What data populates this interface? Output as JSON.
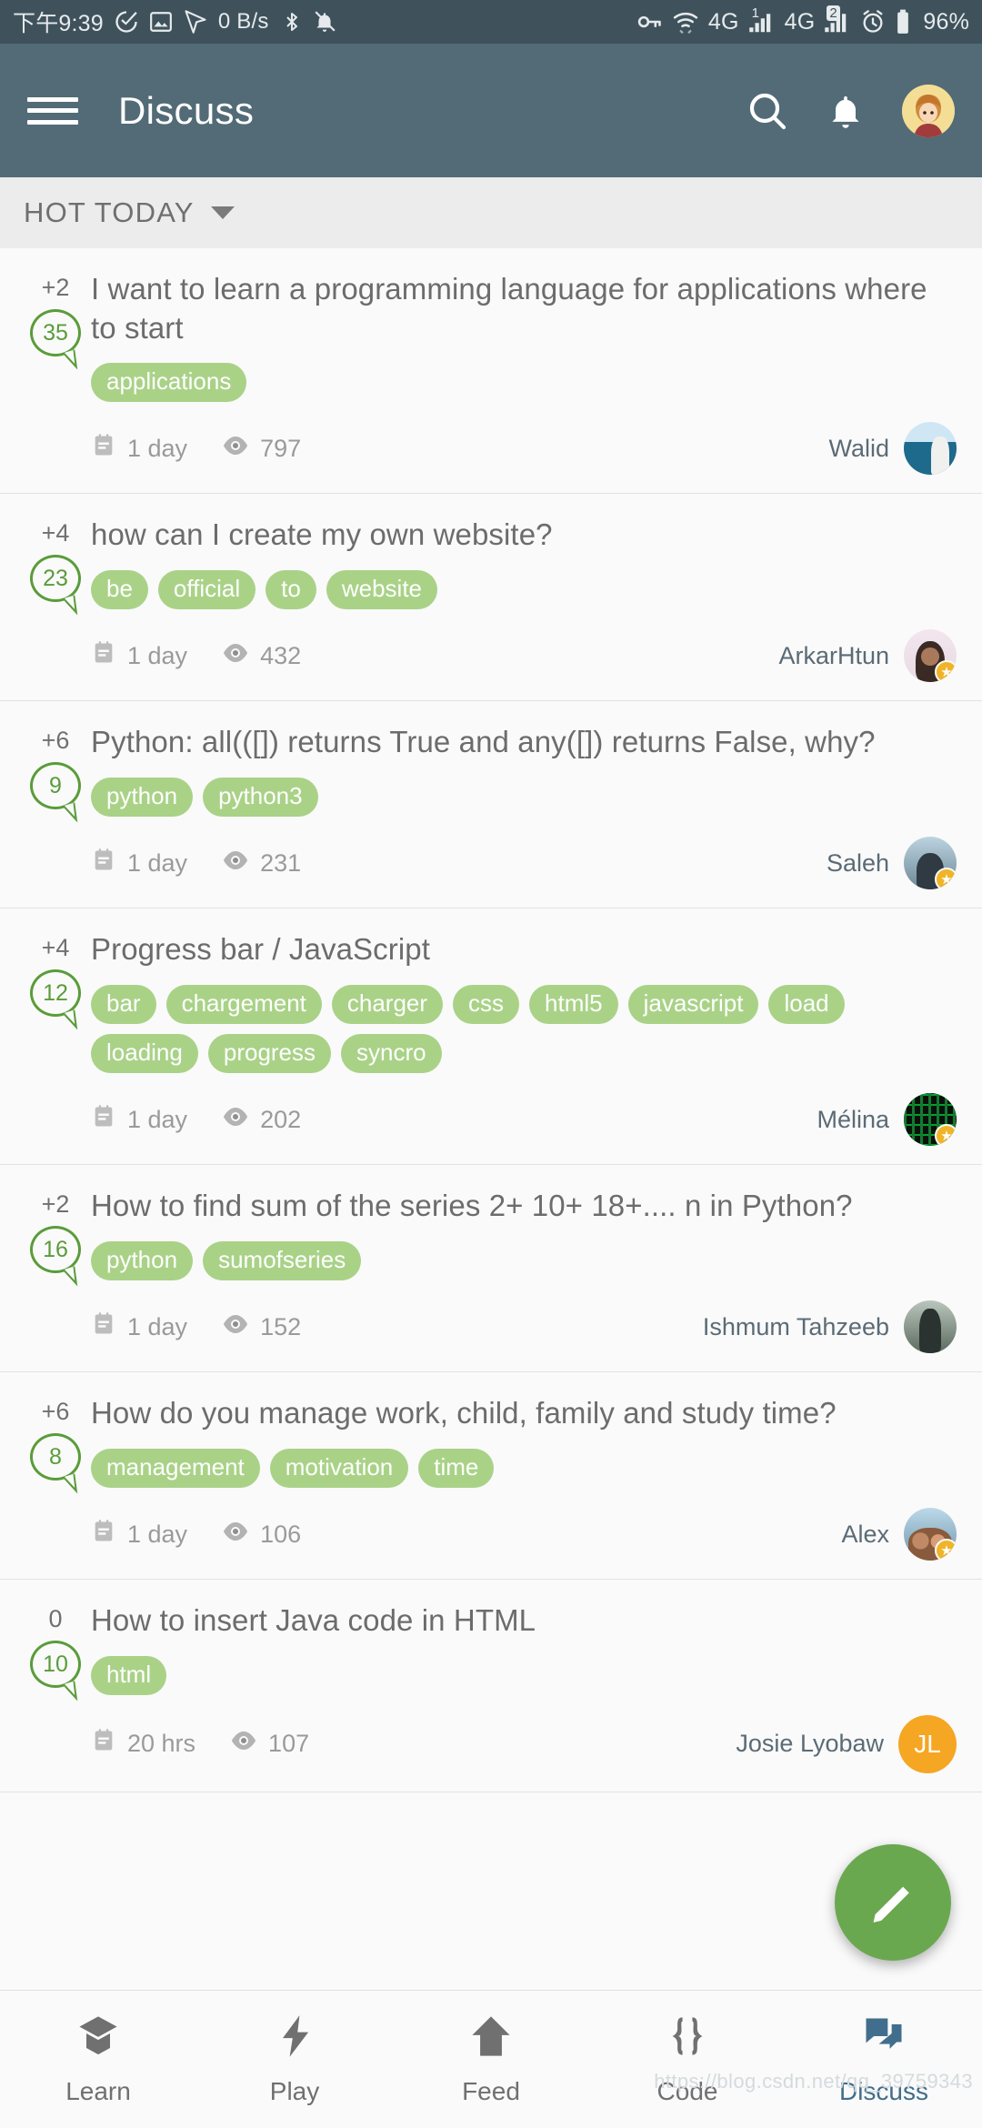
{
  "statusbar": {
    "time": "下午9:39",
    "network_speed": "0 B/s",
    "sim1_label": "4G",
    "sim1_index": "1",
    "sim2_label": "4G",
    "sim2_index": "2",
    "battery_percent": "96%",
    "icons": [
      "check-circle-icon",
      "image-icon",
      "cursor-icon",
      "bluetooth-icon",
      "bell-off-icon",
      "vpn-key-icon",
      "wifi-icon",
      "signal-icon",
      "signal-icon",
      "alarm-icon",
      "battery-icon"
    ]
  },
  "appbar": {
    "title": "Discuss",
    "menu_icon": "hamburger-icon",
    "search_icon": "search-icon",
    "notifications_icon": "bell-icon",
    "avatar_icon": "user-avatar"
  },
  "section": {
    "label": "HOT TODAY",
    "caret_icon": "chevron-down-icon"
  },
  "colors": {
    "appbar": "#526b77",
    "statusbar": "#3f525c",
    "tag": "#a9d287",
    "bubble": "#5a9c3a",
    "fab": "#6aa84f",
    "active_nav": "#416e8c"
  },
  "posts": [
    {
      "votes": "+2",
      "answers": "35",
      "title": "I want to learn a programming language for applications where to start",
      "tags": [
        "applications"
      ],
      "age": "1 day",
      "views": "797",
      "author": "Walid",
      "avatar_class": "ph-walid",
      "badge": false
    },
    {
      "votes": "+4",
      "answers": "23",
      "title": "how can I create my own website?",
      "tags": [
        "be",
        "official",
        "to",
        "website"
      ],
      "age": "1 day",
      "views": "432",
      "author": "ArkarHtun",
      "avatar_class": "ph-arkar",
      "badge": true
    },
    {
      "votes": "+6",
      "answers": "9",
      "title": "Python: all(([]) returns True and any([]) returns False, why?",
      "tags": [
        "python",
        "python3"
      ],
      "age": "1 day",
      "views": "231",
      "author": "Saleh",
      "avatar_class": "ph-saleh",
      "badge": true
    },
    {
      "votes": "+4",
      "answers": "12",
      "title": "Progress bar / JavaScript",
      "tags": [
        "bar",
        "chargement",
        "charger",
        "css",
        "html5",
        "javascript",
        "load",
        "loading",
        "progress",
        "syncro"
      ],
      "age": "1 day",
      "views": "202",
      "author": "Mélina",
      "avatar_class": "ph-melina",
      "badge": true
    },
    {
      "votes": "+2",
      "answers": "16",
      "title": "How to find sum of the series 2+ 10+ 18+.... n in Python?",
      "tags": [
        "python",
        "sumofseries"
      ],
      "age": "1 day",
      "views": "152",
      "author": "Ishmum Tahzeeb",
      "avatar_class": "ph-ishmum",
      "badge": false
    },
    {
      "votes": "+6",
      "answers": "8",
      "title": "How do you manage work, child, family and study time?",
      "tags": [
        "management",
        "motivation",
        "time"
      ],
      "age": "1 day",
      "views": "106",
      "author": "Alex",
      "avatar_class": "ph-alex",
      "badge": true
    },
    {
      "votes": "0",
      "answers": "10",
      "title": "How  to insert Java code in HTML",
      "tags": [
        "html"
      ],
      "age": "20 hrs",
      "views": "107",
      "author": "Josie Lyobaw",
      "avatar_initials": "JL",
      "badge": false
    }
  ],
  "fab": {
    "icon": "pencil-icon",
    "label": "Compose"
  },
  "bottomnav": {
    "items": [
      {
        "label": "Learn",
        "icon": "graduation-cap-icon",
        "active": false
      },
      {
        "label": "Play",
        "icon": "bolt-icon",
        "active": false
      },
      {
        "label": "Feed",
        "icon": "home-icon",
        "active": false
      },
      {
        "label": "Code",
        "icon": "braces-icon",
        "active": false
      },
      {
        "label": "Discuss",
        "icon": "chat-icon",
        "active": true
      }
    ]
  },
  "watermark": "https://blog.csdn.net/qq_39759343"
}
